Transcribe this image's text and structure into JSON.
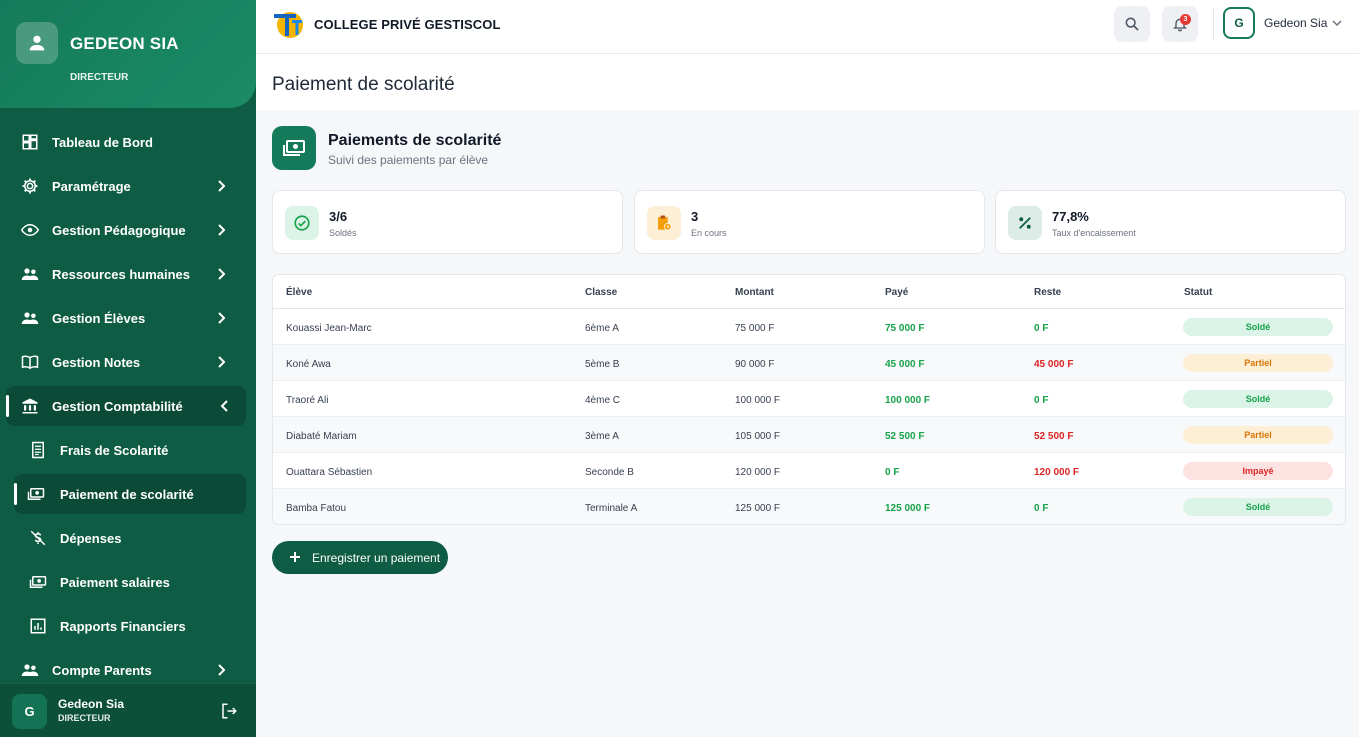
{
  "sidebar": {
    "user_name": "GEDEON SIA",
    "user_role": "DIRECTEUR",
    "items": [
      {
        "label": "Tableau de Bord",
        "icon": "dashboard-icon"
      },
      {
        "label": "Paramétrage",
        "icon": "gear-icon"
      },
      {
        "label": "Gestion Pédagogique",
        "icon": "eye-icon"
      },
      {
        "label": "Ressources humaines",
        "icon": "users-icon"
      },
      {
        "label": "Gestion Élèves",
        "icon": "users-icon"
      },
      {
        "label": "Gestion Notes",
        "icon": "book-icon"
      },
      {
        "label": "Gestion Comptabilité",
        "icon": "bank-icon"
      },
      {
        "label": "Frais de Scolarité",
        "icon": "receipt-icon"
      },
      {
        "label": "Paiement de scolarité",
        "icon": "money-icon"
      },
      {
        "label": "Dépenses",
        "icon": "money-off-icon"
      },
      {
        "label": "Paiement salaires",
        "icon": "money-icon"
      },
      {
        "label": "Rapports Financiers",
        "icon": "chart-icon"
      },
      {
        "label": "Compte Parents",
        "icon": "users-icon"
      }
    ],
    "footer": {
      "initial": "G",
      "name": "Gedeon Sia",
      "role": "DIRECTEUR"
    }
  },
  "header": {
    "school_name": "COLLEGE PRIVÉ GESTISCOL",
    "notifications_count": "3",
    "user_initial": "G",
    "user_name": "Gedeon Sia"
  },
  "page": {
    "title": "Paiement de scolarité",
    "section_title": "Paiements de scolarité",
    "section_subtitle": "Suivi des paiements par élève"
  },
  "stats": [
    {
      "value": "3/6",
      "label": "Soldés"
    },
    {
      "value": "3",
      "label": "En cours"
    },
    {
      "value": "77,8%",
      "label": "Taux d'encaissement"
    }
  ],
  "table": {
    "headers": [
      "Élève",
      "Classe",
      "Montant",
      "Payé",
      "Reste",
      "Statut"
    ],
    "rows": [
      {
        "eleve": "Kouassi Jean-Marc",
        "classe": "6ème A",
        "montant": "75 000 F",
        "paye": "75 000 F",
        "reste": "0 F",
        "statut": "Soldé"
      },
      {
        "eleve": "Koné Awa",
        "classe": "5ème B",
        "montant": "90 000 F",
        "paye": "45 000 F",
        "reste": "45 000 F",
        "statut": "Partiel"
      },
      {
        "eleve": "Traoré Ali",
        "classe": "4ème C",
        "montant": "100 000 F",
        "paye": "100 000 F",
        "reste": "0 F",
        "statut": "Soldé"
      },
      {
        "eleve": "Diabaté Mariam",
        "classe": "3ème A",
        "montant": "105 000 F",
        "paye": "52 500 F",
        "reste": "52 500 F",
        "statut": "Partiel"
      },
      {
        "eleve": "Ouattara Sébastien",
        "classe": "Seconde B",
        "montant": "120 000 F",
        "paye": "0 F",
        "reste": "120 000 F",
        "statut": "Impayé"
      },
      {
        "eleve": "Bamba Fatou",
        "classe": "Terminale A",
        "montant": "125 000 F",
        "paye": "125 000 F",
        "reste": "0 F",
        "statut": "Soldé"
      }
    ]
  },
  "actions": {
    "add_payment": "Enregistrer un paiement"
  },
  "colors": {
    "primary": "#0f5c44",
    "accent": "#157a59",
    "success": "#16a34a",
    "danger": "#dc2626",
    "warning": "#d97706"
  }
}
